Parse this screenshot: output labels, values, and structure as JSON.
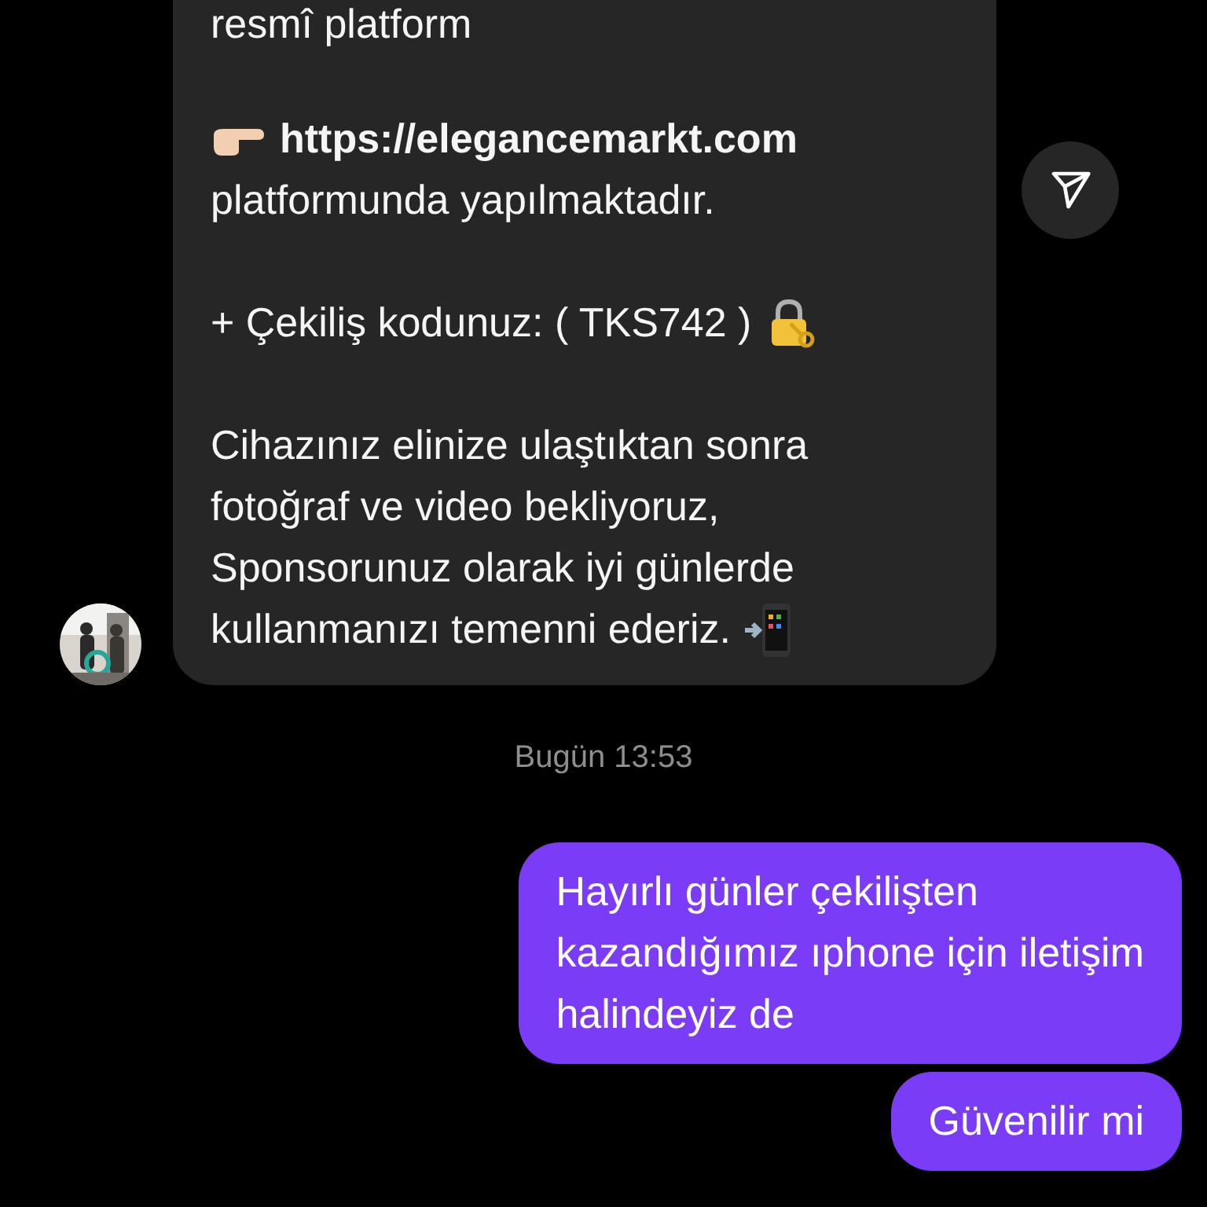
{
  "incoming_message": {
    "paragraphs": [
      {
        "kind": "text",
        "lines": [
          "resmî platform"
        ]
      },
      {
        "kind": "link",
        "link": "https://elegancemarkt.com",
        "lines": [
          "platformunda yapılmaktadır."
        ]
      },
      {
        "kind": "code",
        "lines": [
          "+ Çekiliş kodunuz: ( TKS742 )"
        ]
      },
      {
        "kind": "closing",
        "lines": [
          "Cihazınız elinize ulaştıktan sonra",
          "fotoğraf ve video bekliyoruz,",
          "Sponsorunuz olarak iyi günlerde",
          "kullanmanızı temenni ederiz."
        ]
      }
    ]
  },
  "timestamp": "Bugün 13:53",
  "outgoing_messages": [
    {
      "lines": [
        "Hayırlı günler çekilişten",
        "kazandığımız ıphone için iletişim",
        "halindeyiz de"
      ]
    },
    {
      "lines": [
        "Güvenilir mi"
      ]
    }
  ]
}
